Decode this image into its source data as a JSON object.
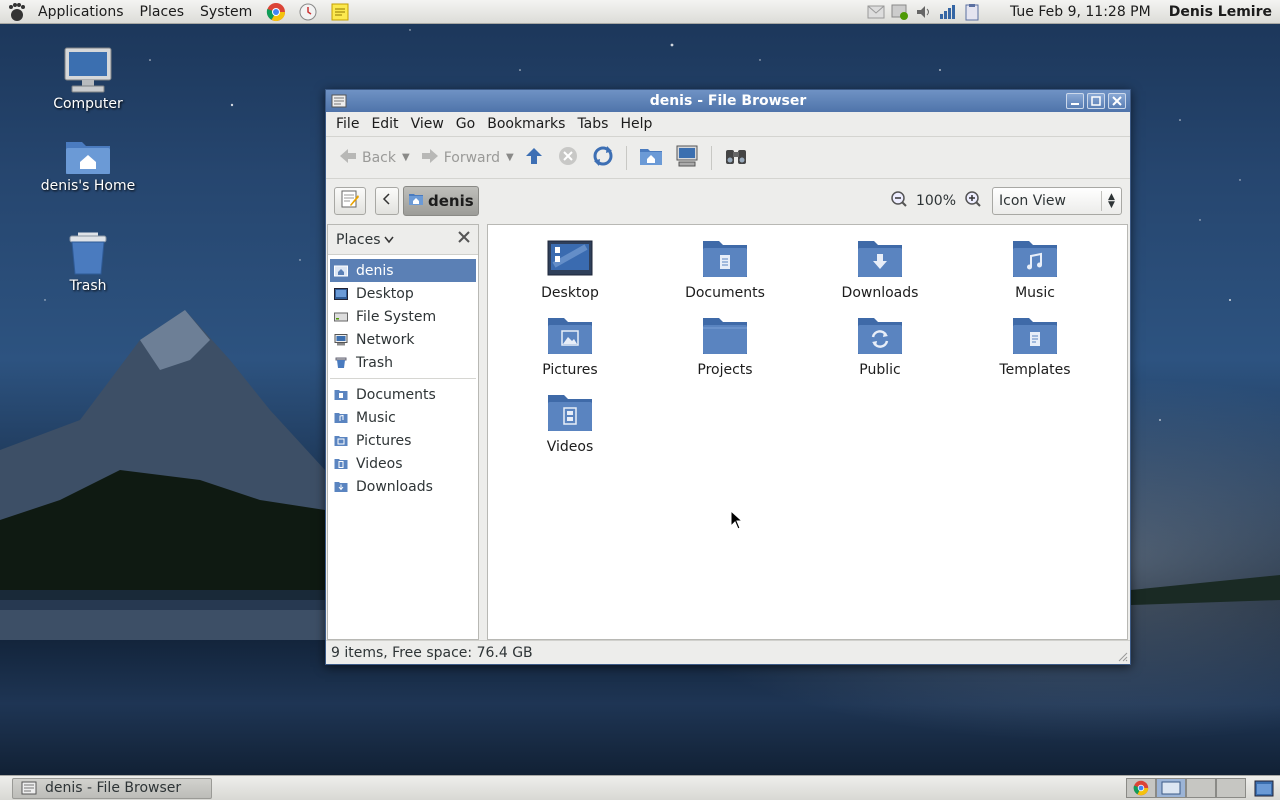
{
  "top_panel": {
    "menus": [
      "Applications",
      "Places",
      "System"
    ],
    "launchers": [
      "chrome-icon",
      "clock-app-icon",
      "notes-icon"
    ],
    "tray": [
      "mail-icon",
      "update-icon",
      "volume-icon",
      "signal-icon",
      "clipboard-icon"
    ],
    "clock": "Tue Feb  9, 11:28 PM",
    "user": "Denis Lemire"
  },
  "desktop": {
    "icons": [
      {
        "label": "Computer",
        "icon": "computer-icon"
      },
      {
        "label": "denis's Home",
        "icon": "home-folder-icon"
      },
      {
        "label": "Trash",
        "icon": "trash-icon"
      }
    ]
  },
  "window": {
    "title": "denis - File Browser",
    "menu": [
      "File",
      "Edit",
      "View",
      "Go",
      "Bookmarks",
      "Tabs",
      "Help"
    ],
    "toolbar": {
      "back": "Back",
      "forward": "Forward"
    },
    "location": {
      "crumb": "denis",
      "zoom": "100%",
      "view_mode": "Icon View"
    },
    "sidebar": {
      "header": "Places",
      "places": [
        {
          "label": "denis",
          "selected": true
        },
        {
          "label": "Desktop"
        },
        {
          "label": "File System"
        },
        {
          "label": "Network"
        },
        {
          "label": "Trash"
        }
      ],
      "bookmarks": [
        {
          "label": "Documents"
        },
        {
          "label": "Music"
        },
        {
          "label": "Pictures"
        },
        {
          "label": "Videos"
        },
        {
          "label": "Downloads"
        }
      ]
    },
    "files": [
      {
        "label": "Desktop",
        "icon": "desktop-folder-icon"
      },
      {
        "label": "Documents",
        "icon": "documents-folder-icon"
      },
      {
        "label": "Downloads",
        "icon": "downloads-folder-icon"
      },
      {
        "label": "Music",
        "icon": "music-folder-icon"
      },
      {
        "label": "Pictures",
        "icon": "pictures-folder-icon"
      },
      {
        "label": "Projects",
        "icon": "folder-icon"
      },
      {
        "label": "Public",
        "icon": "public-folder-icon"
      },
      {
        "label": "Templates",
        "icon": "templates-folder-icon"
      },
      {
        "label": "Videos",
        "icon": "videos-folder-icon"
      }
    ],
    "status": "9 items, Free space: 76.4 GB"
  },
  "taskbar": {
    "task": "denis - File Browser"
  },
  "colors": {
    "selection": "#5b80b5",
    "titlebar": "#5a7fb5",
    "folder": "#5a84c0"
  }
}
